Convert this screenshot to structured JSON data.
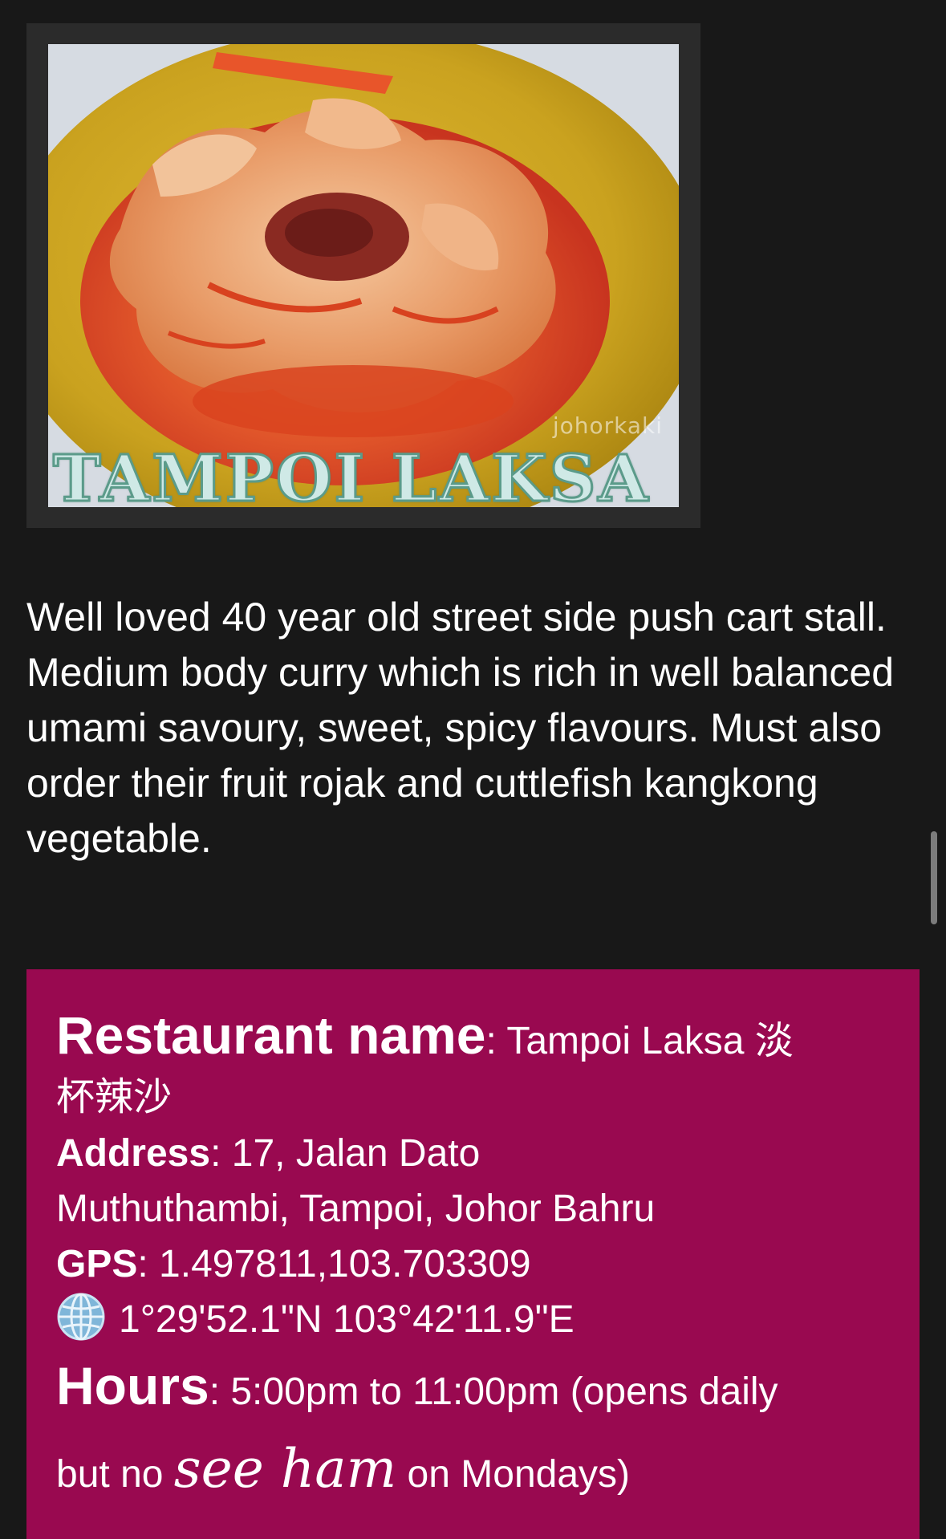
{
  "photo": {
    "caption": "TAMPOI LAKSA",
    "watermark": "johorkaki"
  },
  "description": "Well loved 40 year old street side push cart stall. Medium body curry which is rich in well balanced umami savoury, sweet, spicy flavours. Must also order their fruit rojak and cuttlefish kangkong vegetable.",
  "info": {
    "name_label": "Restaurant name",
    "name_value_line1": "Tampoi Laksa 淡",
    "name_value_line2": "杯辣沙",
    "address_label": "Address",
    "address_value_line1": "17, Jalan Dato",
    "address_value_line2": "Muthuthambi, Tampoi, Johor Bahru",
    "gps_label": "GPS",
    "gps_value": "1.497811,103.703309",
    "coords_icon": "globe-icon",
    "coords_value": "1°29'52.1\"N 103°42'11.9\"E",
    "hours_label": "Hours",
    "hours_value_line1": "5:00pm to 11:00pm (opens daily",
    "hours_value_line2_start": "but no ",
    "hours_value_line2_emph": "see ham",
    "hours_value_line2_end": " on Mondays)"
  },
  "colors": {
    "background": "#181818",
    "info_box": "#990950",
    "text": "#ffffff"
  }
}
